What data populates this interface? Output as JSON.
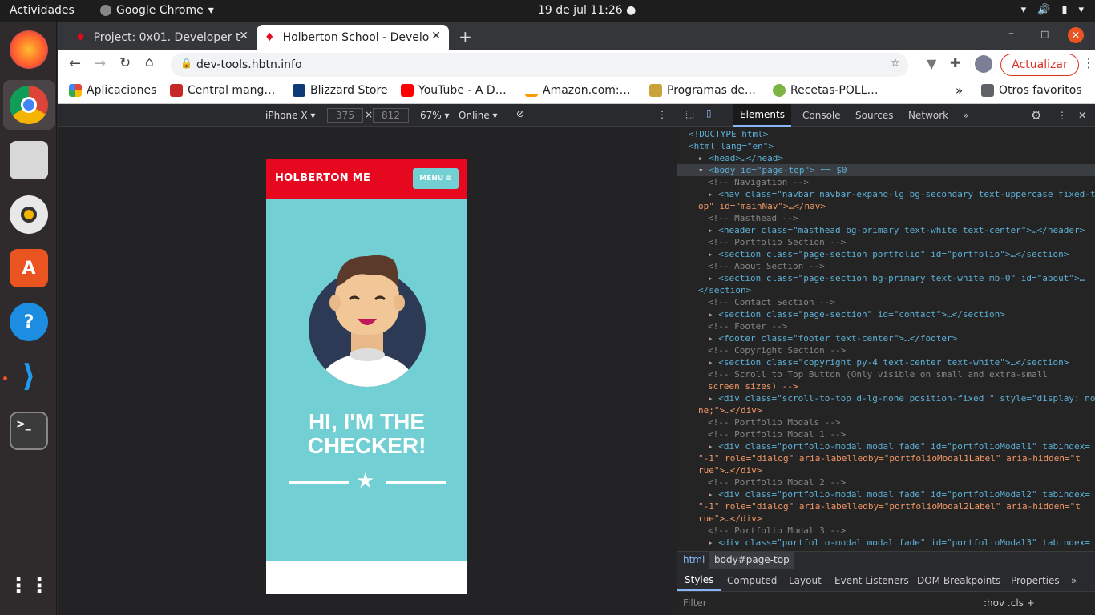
{
  "topbar": {
    "activities": "Actividades",
    "app_name": "Google Chrome",
    "clock": "19 de jul  11:26"
  },
  "browser": {
    "tabs": [
      {
        "label": "Project: 0x01. Developer t"
      },
      {
        "label": "Holberton School - Develo"
      }
    ],
    "url": "dev-tools.hbtn.info",
    "update_label": "Actualizar",
    "bookmarks": [
      {
        "label": "Aplicaciones"
      },
      {
        "label": "Central mang…"
      },
      {
        "label": "Blizzard Store"
      },
      {
        "label": "YouTube - A D…"
      },
      {
        "label": "Amazon.com:…"
      },
      {
        "label": "Programas de…"
      },
      {
        "label": "Recetas-POLL…"
      }
    ],
    "other_bookmarks": "Otros favoritos"
  },
  "device_toolbar": {
    "device": "iPhone X",
    "width": "375",
    "height": "812",
    "zoom": "67%",
    "throttle": "Online"
  },
  "phone_page": {
    "brand": "HOLBERTON ME",
    "menu_label": "MENU",
    "heading_line1": "HI, I'M THE",
    "heading_line2": "CHECKER!"
  },
  "devtools": {
    "tabs": [
      "Elements",
      "Console",
      "Sources",
      "Network"
    ],
    "tree": [
      "<!DOCTYPE html>",
      "<html lang=\"en\">",
      "<head>…</head>",
      "<body id=\"page-top\"> == $0",
      "<!-- Navigation -->",
      "<nav class=\"navbar navbar-expand-lg bg-secondary text-uppercase fixed-t",
      "op\" id=\"mainNav\">…</nav>",
      "<!-- Masthead -->",
      "<header class=\"masthead bg-primary text-white text-center\">…</header>",
      "<!-- Portfolio Section -->",
      "<section class=\"page-section portfolio\" id=\"portfolio\">…</section>",
      "<!-- About Section -->",
      "<section class=\"page-section bg-primary text-white mb-0\" id=\"about\">…",
      "</section>",
      "<!-- Contact Section -->",
      "<section class=\"page-section\" id=\"contact\">…</section>",
      "<!-- Footer -->",
      "<footer class=\"footer text-center\">…</footer>",
      "<!-- Copyright Section -->",
      "<section class=\"copyright py-4 text-center text-white\">…</section>",
      "<!-- Scroll to Top Button (Only visible on small and extra-small",
      "screen sizes) -->",
      "<div class=\"scroll-to-top d-lg-none position-fixed \" style=\"display: no",
      "ne;\">…</div>",
      "<!-- Portfolio Modals -->",
      "<!-- Portfolio Modal 1 -->",
      "<div class=\"portfolio-modal modal fade\" id=\"portfolioModal1\" tabindex=",
      "\"-1\" role=\"dialog\" aria-labelledby=\"portfolioModal1Label\" aria-hidden=\"t",
      "rue\">…</div>",
      "<!-- Portfolio Modal 2 -->",
      "<div class=\"portfolio-modal modal fade\" id=\"portfolioModal2\" tabindex=",
      "\"-1\" role=\"dialog\" aria-labelledby=\"portfolioModal2Label\" aria-hidden=\"t",
      "rue\">…</div>",
      "<!-- Portfolio Modal 3 -->",
      "<div class=\"portfolio-modal modal fade\" id=\"portfolioModal3\" tabindex=",
      "\"-1\" role=\"dialog\" aria-labelledby=\"portfolioModal3Label\" aria-hidden=\"t"
    ],
    "breadcrumb": [
      "html",
      "body#page-top"
    ],
    "style_tabs": [
      "Styles",
      "Computed",
      "Layout",
      "Event Listeners",
      "DOM Breakpoints",
      "Properties"
    ],
    "filter_placeholder": "Filter",
    "filter_tools": ":hov .cls +"
  },
  "colors": {
    "brand_red": "#e5081e",
    "masthead_teal": "#72cfd3",
    "menu_btn": "#72cfd3",
    "update_btn": "#d93025"
  }
}
